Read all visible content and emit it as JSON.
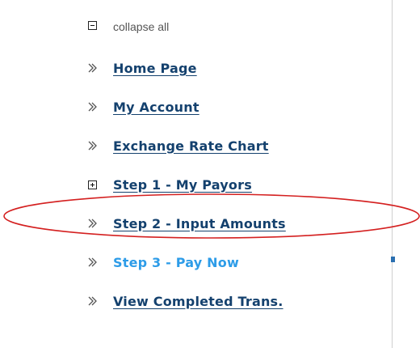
{
  "collapse_all": {
    "icon": "minus-box-icon",
    "label": "collapse all"
  },
  "nav": {
    "items": [
      {
        "label": "Home Page",
        "icon": "chevron-right-icon"
      },
      {
        "label": "My Account",
        "icon": "chevron-right-icon"
      },
      {
        "label": "Exchange Rate Chart",
        "icon": "chevron-right-icon"
      },
      {
        "label": "Step 1 - My Payors",
        "icon": "plus-box-icon"
      },
      {
        "label": "Step 2 - Input Amounts",
        "icon": "chevron-right-icon",
        "highlighted": true
      },
      {
        "label": "Step 3 - Pay Now",
        "icon": "chevron-right-icon",
        "active": true
      },
      {
        "label": "View Completed Trans.",
        "icon": "chevron-right-icon"
      }
    ]
  },
  "colors": {
    "link": "#14416e",
    "active_link": "#2d9ce8",
    "highlight_ellipse": "#d42020",
    "muted_text": "#555555"
  }
}
